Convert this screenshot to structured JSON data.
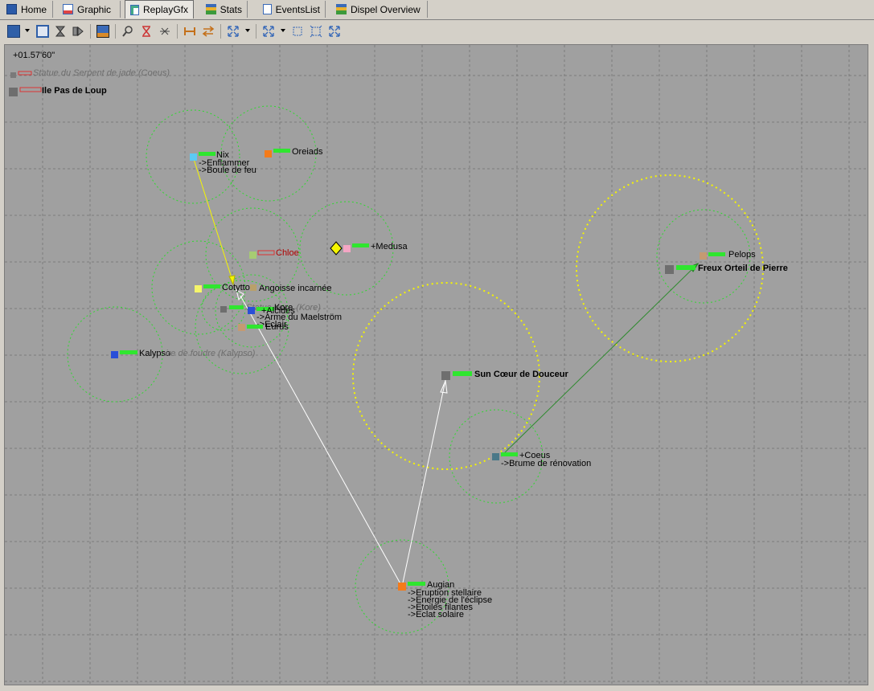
{
  "tabs": [
    {
      "label": "Home",
      "icon": "home-icon"
    },
    {
      "label": "Graphic",
      "icon": "graphic-icon"
    },
    {
      "label": "ReplayGfx",
      "icon": "replay-icon",
      "active": true
    },
    {
      "label": "Stats",
      "icon": "stats-icon"
    },
    {
      "label": "EventsList",
      "icon": "list-icon"
    },
    {
      "label": "Dispel Overview",
      "icon": "dispel-icon"
    }
  ],
  "toolbar": [
    "save-icon",
    "dropdown-arrow-icon",
    "bookmark-icon",
    "hourglass-icon",
    "forward-icon",
    "export-icon",
    "find-icon",
    "filter-icon",
    "collapse-icon",
    "range-icon",
    "swap-icon",
    "expand-icon",
    "dropdown-arrow-icon",
    "fit-icon",
    "select-icon",
    "select-alt-icon",
    "zoom-fit-icon"
  ],
  "replay": {
    "time": "+01.57'60\"",
    "entities": {
      "statue": {
        "name": "Statue du Serpent de jade (Coeus)"
      },
      "ile": {
        "name": "Ile Pas de Loup"
      },
      "nix": {
        "name": "Nix",
        "casts": [
          "->Enflammer",
          "->Boule de feu"
        ]
      },
      "oreiads": {
        "name": "Oreiads"
      },
      "chloe": {
        "name": "Chloe"
      },
      "medusa": {
        "name": "+Medusa"
      },
      "cotytto": {
        "name": "Cotytto"
      },
      "angoisse": {
        "name": "Angoisse incarnée"
      },
      "kore": {
        "name": "Kore"
      },
      "kore_ghost": {
        "name": "Statue de ... (Kore)"
      },
      "alcides": {
        "name": "+Alcides",
        "casts": [
          "->Arme du Maelström",
          "->Eclair"
        ]
      },
      "eurus": {
        "name": "Eurus"
      },
      "kalypso": {
        "name": "Kalypso"
      },
      "kalypso_ghost": {
        "name": "...ire de foudre (Kalypso)"
      },
      "pelops": {
        "name": "Pelops"
      },
      "freux": {
        "name": "Freux Orteil de Pierre"
      },
      "sun": {
        "name": "Sun Cœur de Douceur"
      },
      "coeus": {
        "name": "+Coeus",
        "casts": [
          "->Brume de rénovation"
        ]
      },
      "augian": {
        "name": "Augian",
        "casts": [
          "->Eruption stellaire",
          "->Energie de l'éclipse",
          "->Etoiles filantes",
          "->Eclat solaire"
        ]
      }
    }
  }
}
